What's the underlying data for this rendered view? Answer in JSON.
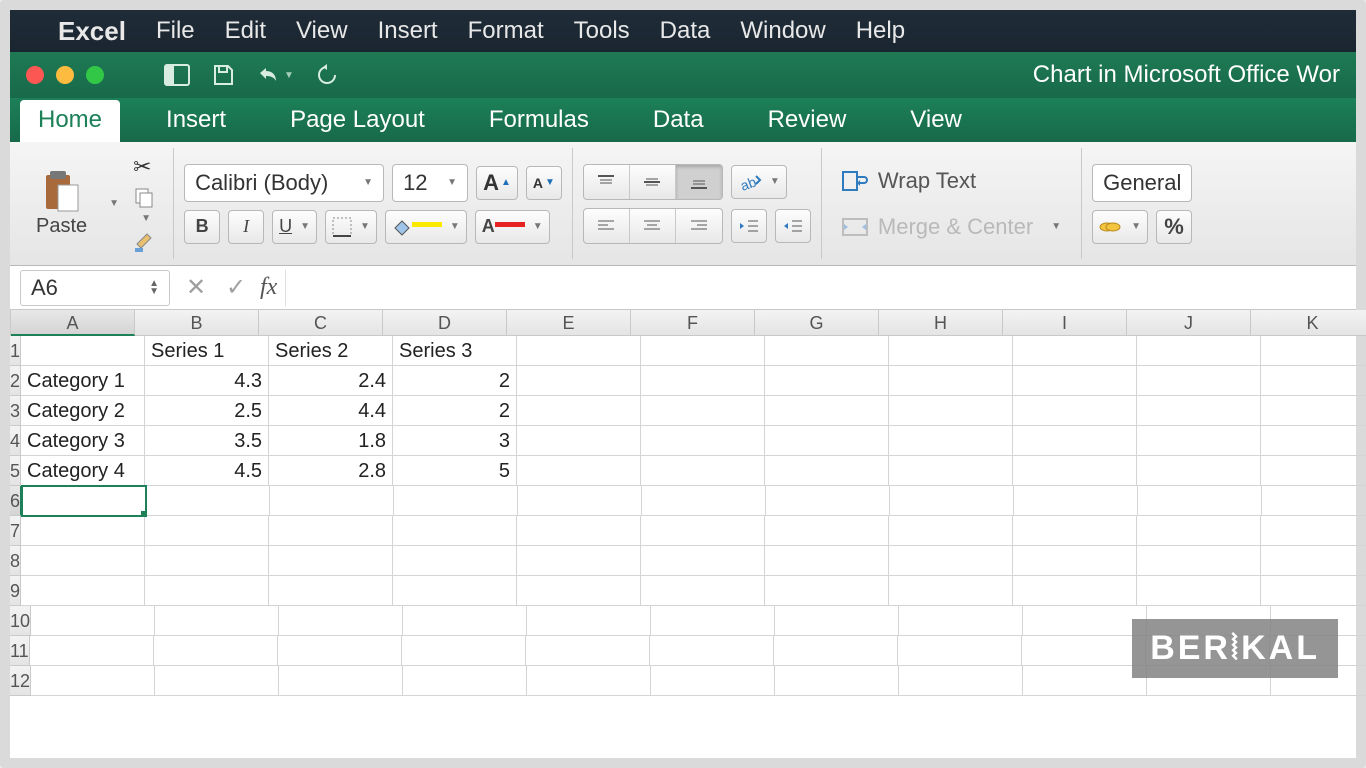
{
  "menubar": {
    "app": "Excel",
    "items": [
      "File",
      "Edit",
      "View",
      "Insert",
      "Format",
      "Tools",
      "Data",
      "Window",
      "Help"
    ]
  },
  "window_title": "Chart in Microsoft Office Wor",
  "ribbon": {
    "tabs": [
      "Home",
      "Insert",
      "Page Layout",
      "Formulas",
      "Data",
      "Review",
      "View"
    ],
    "active": "Home"
  },
  "toolbar": {
    "paste_label": "Paste",
    "font_name": "Calibri (Body)",
    "font_size": "12",
    "wrap_text": "Wrap Text",
    "merge_center": "Merge & Center",
    "number_format": "General"
  },
  "formula_bar": {
    "cell_ref": "A6",
    "value": ""
  },
  "columns": [
    "A",
    "B",
    "C",
    "D",
    "E",
    "F",
    "G",
    "H",
    "I",
    "J",
    "K"
  ],
  "row_numbers": [
    1,
    2,
    3,
    4,
    5,
    6,
    7,
    8,
    9,
    10,
    11,
    12
  ],
  "active_cell": "A6",
  "sheet": {
    "headers": {
      "B1": "Series 1",
      "C1": "Series 2",
      "D1": "Series 3"
    },
    "rows": [
      {
        "label": "Category 1",
        "s1": "4.3",
        "s2": "2.4",
        "s3": "2"
      },
      {
        "label": "Category 2",
        "s1": "2.5",
        "s2": "4.4",
        "s3": "2"
      },
      {
        "label": "Category 3",
        "s1": "3.5",
        "s2": "1.8",
        "s3": "3"
      },
      {
        "label": "Category 4",
        "s1": "4.5",
        "s2": "2.8",
        "s3": "5"
      }
    ]
  },
  "chart_data": {
    "type": "bar",
    "categories": [
      "Category 1",
      "Category 2",
      "Category 3",
      "Category 4"
    ],
    "series": [
      {
        "name": "Series 1",
        "values": [
          4.3,
          2.5,
          3.5,
          4.5
        ]
      },
      {
        "name": "Series 2",
        "values": [
          2.4,
          4.4,
          1.8,
          2.8
        ]
      },
      {
        "name": "Series 3",
        "values": [
          2,
          2,
          3,
          5
        ]
      }
    ],
    "title": "",
    "xlabel": "",
    "ylabel": ""
  },
  "watermark": "BERAKAL"
}
